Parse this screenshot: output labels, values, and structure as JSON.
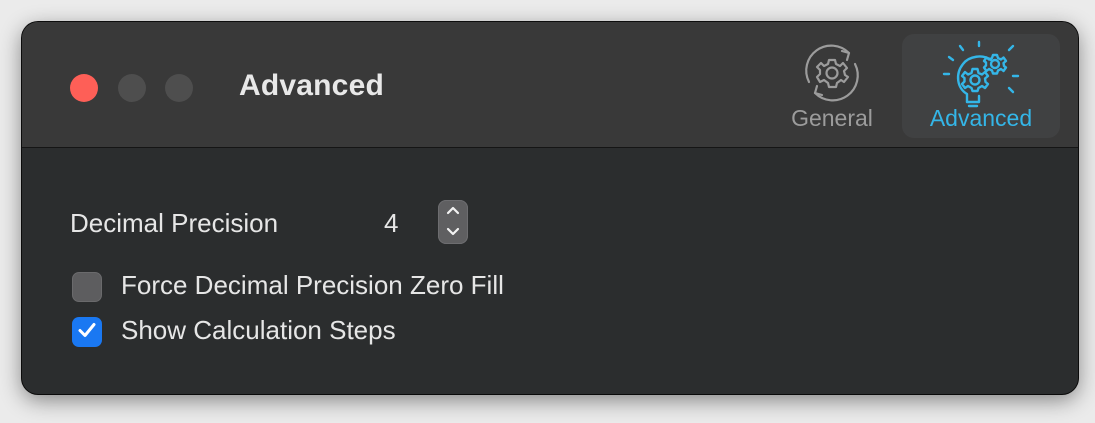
{
  "window": {
    "title": "Advanced"
  },
  "toolbar": {
    "tabs": [
      {
        "label": "General",
        "icon": "gear-cycle-icon",
        "selected": false
      },
      {
        "label": "Advanced",
        "icon": "gear-lightbulb-icon",
        "selected": true
      }
    ]
  },
  "settings": {
    "decimal_precision_label": "Decimal Precision",
    "decimal_precision_value": "4",
    "zero_fill_label": "Force Decimal Precision Zero Fill",
    "zero_fill_checked": false,
    "show_steps_label": "Show Calculation Steps",
    "show_steps_checked": true
  },
  "colors": {
    "accent": "#34b6e8",
    "checkbox_checked": "#1a78f2",
    "close_button": "#fe5f57"
  }
}
